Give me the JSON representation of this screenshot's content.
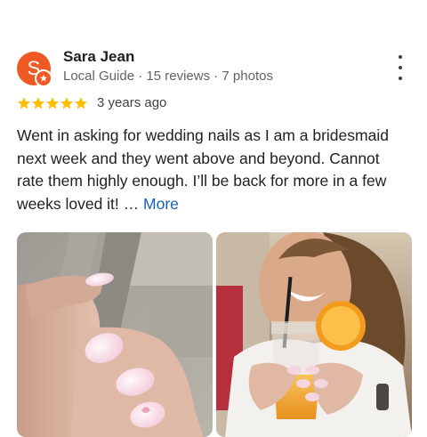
{
  "reviewer": {
    "avatar_letter": "S",
    "name": "Sara Jean",
    "meta": "Local Guide · 15 reviews · 7 photos"
  },
  "review": {
    "rating": 5,
    "time_ago": "3 years ago",
    "text": "Went in asking for wedding nails as I am a bridesmaid next week and they went above and beyond. Cannot rate them highly enough. I’ll be back for more in a few weeks loved it!",
    "ellipsis": " …",
    "more_label": "More"
  },
  "photos": [
    {
      "description_icon": "nails-closeup-photo"
    },
    {
      "description_icon": "woman-with-drink-photo"
    }
  ],
  "colors": {
    "avatar": "#ef5a24",
    "star": "#fbbc04",
    "link": "#1a5fb4"
  }
}
